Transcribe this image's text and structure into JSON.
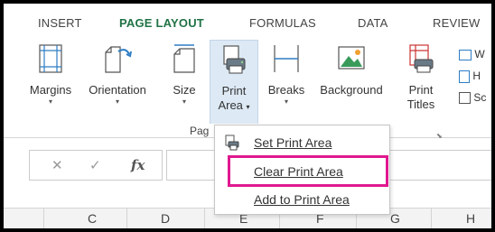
{
  "tabs": [
    "INSERT",
    "PAGE LAYOUT",
    "FORMULAS",
    "DATA",
    "REVIEW"
  ],
  "active_tab": "PAGE LAYOUT",
  "ribbon": {
    "margins": {
      "label": "Margins",
      "icon": "margins-icon"
    },
    "orientation": {
      "label": "Orientation",
      "icon": "orientation-icon"
    },
    "size": {
      "label": "Size",
      "icon": "size-icon"
    },
    "print_area": {
      "label1": "Print",
      "label2": "Area",
      "icon": "print-area-icon"
    },
    "breaks": {
      "label": "Breaks",
      "icon": "breaks-icon"
    },
    "background": {
      "label": "Background",
      "icon": "background-icon"
    },
    "print_titles": {
      "label1": "Print",
      "label2": "Titles",
      "icon": "print-titles-icon"
    },
    "group_label": "Pag",
    "side_items": [
      "W",
      "H",
      "Sc"
    ]
  },
  "formula_bar": {
    "cancel": "✕",
    "enter": "✓",
    "fx": "fx"
  },
  "columns": [
    "C",
    "D",
    "E",
    "F",
    "G",
    "H"
  ],
  "menu": {
    "items": [
      {
        "label": "Set Print Area",
        "icon": "set-print-area-icon"
      },
      {
        "label": "Clear Print Area",
        "icon": ""
      },
      {
        "label": "Add to Print Area",
        "icon": ""
      }
    ],
    "highlighted": "Clear Print Area",
    "highlight_color": "#e0188f"
  },
  "colors": {
    "active_tab": "#217346",
    "hover_bg": "#dde9f4"
  }
}
